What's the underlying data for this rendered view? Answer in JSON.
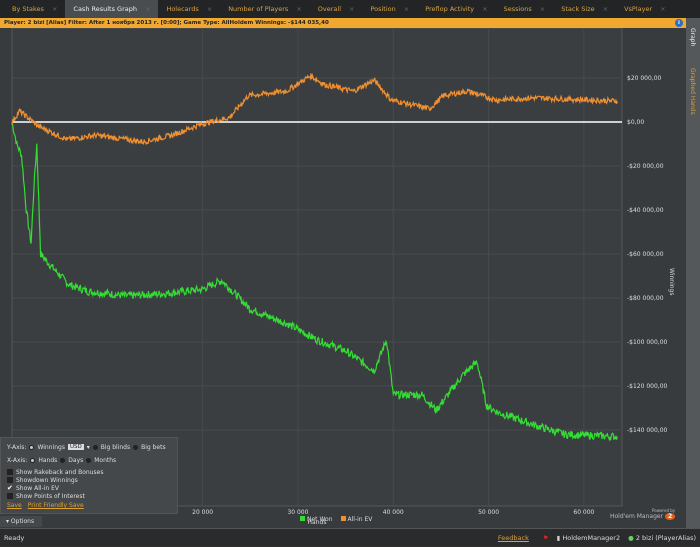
{
  "tabs": [
    "By Stakes",
    "Cash Results Graph",
    "Holecards",
    "Number of Players",
    "Overall",
    "Position",
    "Preflop Activity",
    "Sessions",
    "Stack Size",
    "VsPlayer"
  ],
  "active_tab": 1,
  "filter_text": "Player: 2 bizi [Alias]  Filter: After 1 ноября 2013 г. [0:00]; Game Type: AllHoldem  Winnings: -$144 035,40",
  "sidebar": {
    "graph": "Graph",
    "graphed_hands": "Graphed Hands"
  },
  "options": {
    "y_axis_label": "Y-Axis:",
    "y_winnings": "Winnings",
    "currency": "USD",
    "y_big_blinds": "Big blinds",
    "y_big_bets": "Big bets",
    "x_axis_label": "X-Axis:",
    "x_hands": "Hands",
    "x_days": "Days",
    "x_months": "Months",
    "checks": [
      {
        "label": "Show Rakeback and Bonuses",
        "checked": false
      },
      {
        "label": "Showdown Winnings",
        "checked": false
      },
      {
        "label": "Show All-in EV",
        "checked": true
      },
      {
        "label": "Show Points of Interest",
        "checked": false
      }
    ],
    "save": "Save",
    "print_save": "Print Friendly Save",
    "toggle": "Options"
  },
  "status": {
    "ready": "Ready",
    "feedback": "Feedback",
    "app": "HoldemManager2",
    "user": "2 bizi (PlayerAlias)"
  },
  "brand": {
    "powered": "Powered by",
    "name": "Hold'em Manager",
    "num": "2"
  },
  "chart_data": {
    "type": "line",
    "xlabel": "Hands",
    "ylabel": "Winnings",
    "xlim": [
      0,
      64000
    ],
    "ylim": [
      -160000,
      40000
    ],
    "xticks": [
      20000,
      30000,
      40000,
      50000,
      60000
    ],
    "xtick_labels": [
      "20 000",
      "30 000",
      "40 000",
      "50 000",
      "60 000"
    ],
    "yticks": [
      20000,
      0,
      -20000,
      -40000,
      -60000,
      -80000,
      -100000,
      -120000,
      -140000
    ],
    "ytick_labels": [
      "$20 000,00",
      "$0,00",
      "-$20 000,00",
      "-$40 000,00",
      "-$60 000,00",
      "-$80 000,00",
      "-$100 000,00",
      "-$120 000,00",
      "-$140 000,00"
    ],
    "legend": [
      "Net Won",
      "All-in EV"
    ],
    "series": [
      {
        "name": "Net Won",
        "color": "#33dd33",
        "x": [
          0,
          500,
          1000,
          1500,
          2000,
          2300,
          2600,
          3000,
          4000,
          6000,
          8000,
          12000,
          16000,
          20000,
          22000,
          25000,
          29000,
          32000,
          35000,
          38000,
          39300,
          40000,
          43000,
          44500,
          47300,
          48800,
          49800,
          51000,
          55000,
          58000,
          63500
        ],
        "y": [
          0,
          -10000,
          -15000,
          -40000,
          -55000,
          -30000,
          -10000,
          -60000,
          -65000,
          -74000,
          -77000,
          -79000,
          -78000,
          -76000,
          -72000,
          -85000,
          -92000,
          -99000,
          -104000,
          -113000,
          -99000,
          -124000,
          -124000,
          -131000,
          -115000,
          -109000,
          -129000,
          -132000,
          -138000,
          -142000,
          -143000
        ]
      },
      {
        "name": "All-in EV",
        "color": "#f09030",
        "x": [
          0,
          800,
          2800,
          5800,
          8800,
          13800,
          16800,
          19800,
          22800,
          24800,
          28800,
          31300,
          32800,
          35800,
          38000,
          39800,
          43800,
          45300,
          47800,
          50800,
          54800,
          63500
        ],
        "y": [
          0,
          5000,
          -2000,
          -8000,
          -6000,
          -9000,
          -6000,
          -1000,
          2000,
          12000,
          14000,
          21000,
          17000,
          14000,
          19000,
          10000,
          6000,
          12000,
          14000,
          10000,
          11000,
          9500
        ]
      }
    ]
  }
}
